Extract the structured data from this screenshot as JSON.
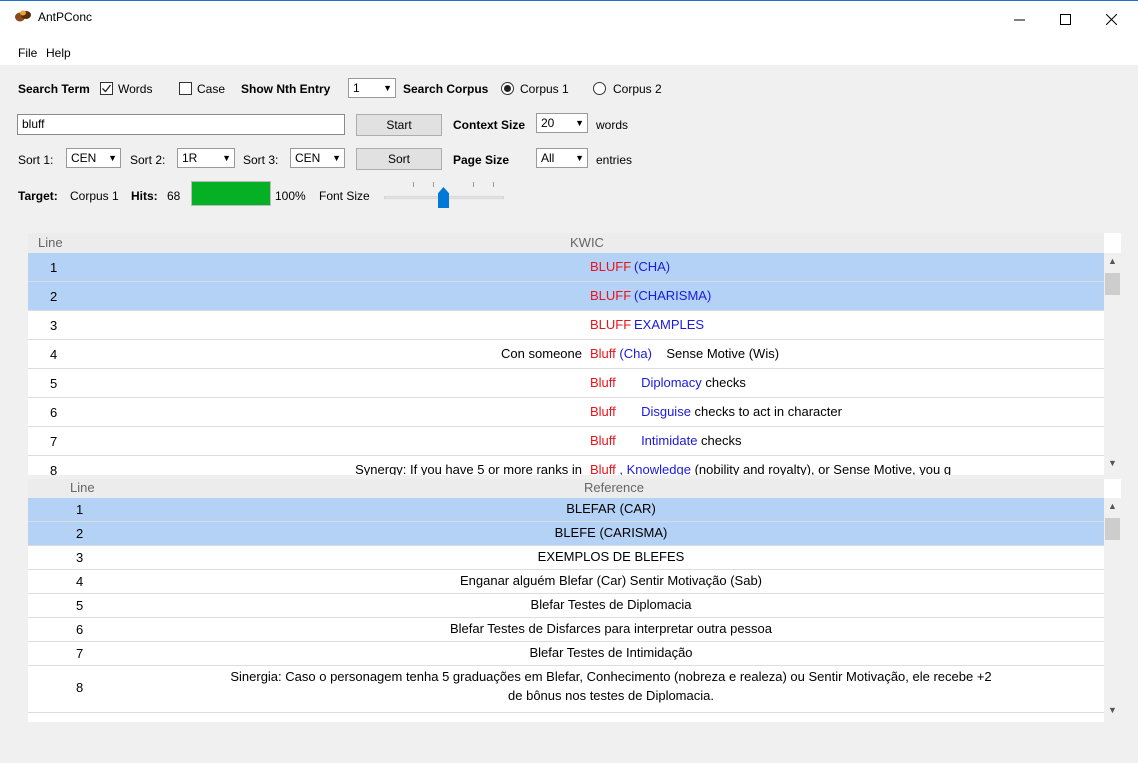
{
  "window": {
    "title": "AntPConc"
  },
  "menu": [
    "File",
    "Help"
  ],
  "controls": {
    "search_term_label": "Search Term",
    "words_label": "Words",
    "words_checked": true,
    "case_label": "Case",
    "case_checked": false,
    "show_nth_label": "Show Nth Entry",
    "show_nth_value": "1",
    "search_corpus_label": "Search Corpus",
    "corpus1_label": "Corpus 1",
    "corpus2_label": "Corpus 2",
    "corpus_selected": "Corpus 1",
    "search_value": "bluff",
    "start_label": "Start",
    "context_size_label": "Context Size",
    "context_size_value": "20",
    "words_unit": "words",
    "sort1_label": "Sort 1:",
    "sort1_value": "CEN",
    "sort2_label": "Sort 2:",
    "sort2_value": "1R",
    "sort3_label": "Sort 3:",
    "sort3_value": "CEN",
    "sort_button": "Sort",
    "page_size_label": "Page Size",
    "page_size_value": "All",
    "entries_unit": "entries",
    "target_label": "Target:",
    "target_value": "Corpus 1",
    "hits_label": "Hits:",
    "hits_value": "68",
    "hit_percent": "100%",
    "hit_fraction": 1.0,
    "font_size_label": "Font Size"
  },
  "kwic_table": {
    "col_line": "Line",
    "col_kwic": "KWIC",
    "rows": [
      {
        "line": "1",
        "left": "",
        "key": "BLUFF",
        "right_blue": "(CHA)",
        "right": "",
        "selected": true
      },
      {
        "line": "2",
        "left": "",
        "key": "BLUFF",
        "right_blue": "(CHARISMA)",
        "right": "",
        "selected": true
      },
      {
        "line": "3",
        "left": "",
        "key": "BLUFF",
        "right_blue": "EXAMPLES",
        "right": "",
        "selected": false
      },
      {
        "line": "4",
        "left": "Con someone",
        "key": "Bluff",
        "right_blue": "(Cha)",
        "right": "Sense Motive (Wis)",
        "selected": false
      },
      {
        "line": "5",
        "left": "",
        "key": "Bluff",
        "right_blue": "Diplomacy",
        "right": "checks",
        "selected": false
      },
      {
        "line": "6",
        "left": "",
        "key": "Bluff",
        "right_blue": "Disguise",
        "right": "checks to act in character",
        "selected": false
      },
      {
        "line": "7",
        "left": "",
        "key": "Bluff",
        "right_blue": "Intimidate",
        "right": "checks",
        "selected": false
      },
      {
        "line": "8",
        "left": "Synergy: If you have 5 or more ranks in",
        "key": "Bluff",
        "right_blue": ", Knowledge",
        "right": "(nobility and royalty), or Sense Motive, you g",
        "selected": false
      }
    ]
  },
  "ref_table": {
    "col_line": "Line",
    "col_ref": "Reference",
    "rows": [
      {
        "line": "1",
        "text": "BLEFAR (CAR)",
        "text2": "",
        "selected": true
      },
      {
        "line": "2",
        "text": "BLEFE (CARISMA)",
        "text2": "",
        "selected": true
      },
      {
        "line": "3",
        "text": "EXEMPLOS DE BLEFES",
        "text2": "",
        "selected": false
      },
      {
        "line": "4",
        "text": "Enganar alguém Blefar (Car) Sentir Motivação (Sab)",
        "text2": "",
        "selected": false
      },
      {
        "line": "5",
        "text": "Blefar Testes de Diplomacia",
        "text2": "",
        "selected": false
      },
      {
        "line": "6",
        "text": "Blefar Testes de Disfarces para interpretar outra pessoa",
        "text2": "",
        "selected": false
      },
      {
        "line": "7",
        "text": "Blefar Testes de Intimidação",
        "text2": "",
        "selected": false
      },
      {
        "line": "8",
        "text": "Sinergia: Caso o personagem tenha 5 graduações em Blefar, Conhecimento (nobreza e realeza) ou Sentir Motivação, ele recebe +2",
        "text2": "de bônus nos testes de Diplomacia.",
        "selected": false
      }
    ]
  },
  "icons": {
    "app": "ant-icon",
    "minimize": "minimize-icon",
    "maximize": "maximize-icon",
    "close": "close-icon"
  }
}
